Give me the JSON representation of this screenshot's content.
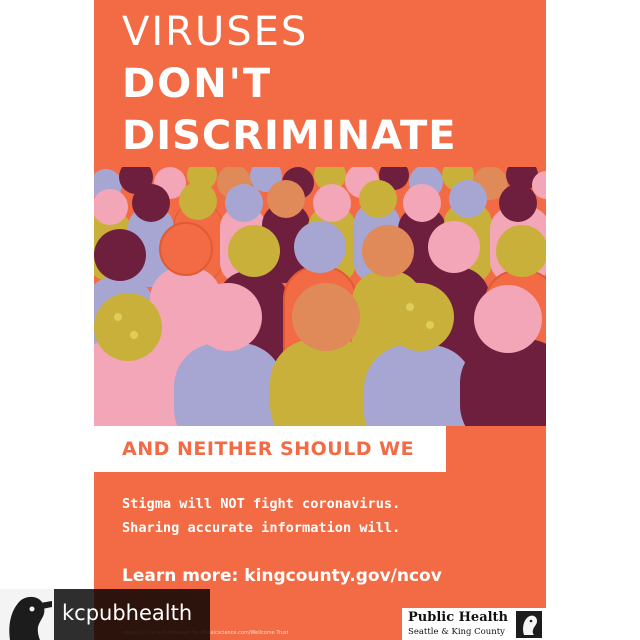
{
  "poster": {
    "headline": [
      "VIRUSES",
      "DON'T",
      "DISCRIMINATE"
    ],
    "banner": "AND NEITHER SHOULD WE",
    "message": [
      "Stigma will NOT fight coronavirus.",
      "Sharing accurate information will."
    ],
    "learn_more": "Learn more: kingcounty.gov/ncov",
    "credit": "Image (C) Sara Andreasson for Mosaicscience.com/Wellcome Trust",
    "logo": {
      "name": "Public Health",
      "subtitle": "Seattle & King County",
      "icon": "king-county-logo-icon"
    },
    "illustration": "crowd-illustration"
  },
  "repost": {
    "username": "kcpubhealth",
    "avatar_icon": "kcpubhealth-avatar-icon"
  },
  "colors": {
    "background": "#f26b44",
    "text": "#ffffff",
    "crowd": [
      "#f26b44",
      "#c9b03a",
      "#a7a6d3",
      "#f3a6b7",
      "#6e1f3e",
      "#e08a5a"
    ]
  }
}
